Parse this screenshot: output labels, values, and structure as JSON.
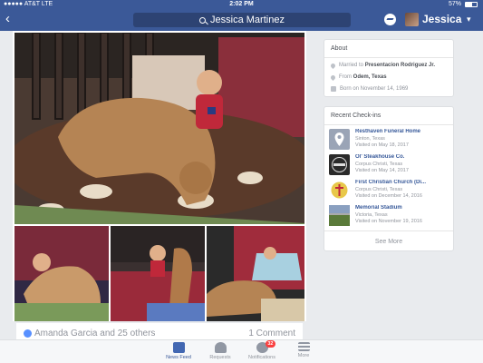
{
  "status_bar": {
    "carrier": "●●●●● AT&T  LTE",
    "time": "2:02 PM",
    "battery": "57%",
    "battery_level": 0.57
  },
  "nav": {
    "back_icon": "chevron-left-icon",
    "search_value": "Jessica Martinez",
    "user_name": "Jessica",
    "chevron": "▾"
  },
  "photos": {
    "count_main": 1,
    "count_small": 3
  },
  "reactions": {
    "text": "Amanda Garcia and 25 others",
    "comments": "1 Comment"
  },
  "about": {
    "title": "About",
    "married_prefix": "Married to ",
    "married_to": "Presentacion Rodriguez Jr.",
    "from_prefix": "From ",
    "from": "Odem, Texas",
    "born": "Born on November 14, 1969"
  },
  "checkins": {
    "title": "Recent Check-ins",
    "items": [
      {
        "name": "Resthaven Funeral Home",
        "location": "Sinton, Texas",
        "visited": "Visited on May 18, 2017",
        "thumb_color": "#9aa4b6"
      },
      {
        "name": "Ol' Steakhouse Co.",
        "location": "Corpus Christi, Texas",
        "visited": "Visited on May 14, 2017",
        "thumb_color": "#2a2a2a"
      },
      {
        "name": "First Christian Church (Di...",
        "location": "Corpus Christi, Texas",
        "visited": "Visited on December 14, 2016",
        "thumb_color": "#e8c84a"
      },
      {
        "name": "Memorial Stadium",
        "location": "Victoria, Texas",
        "visited": "Visited on November 19, 2016",
        "thumb_color": "#6a7a5a"
      }
    ],
    "see_more": "See More"
  },
  "tabbar": {
    "items": [
      {
        "label": "News Feed",
        "icon": "news-feed-icon",
        "active": true
      },
      {
        "label": "Requests",
        "icon": "friend-requests-icon",
        "active": false
      },
      {
        "label": "Notifications",
        "icon": "globe-icon",
        "active": false,
        "badge": "32"
      },
      {
        "label": "More",
        "icon": "menu-icon",
        "active": false
      }
    ]
  },
  "colors": {
    "brand": "#3b5998",
    "link": "#365899",
    "badge": "#fa3e3e"
  }
}
